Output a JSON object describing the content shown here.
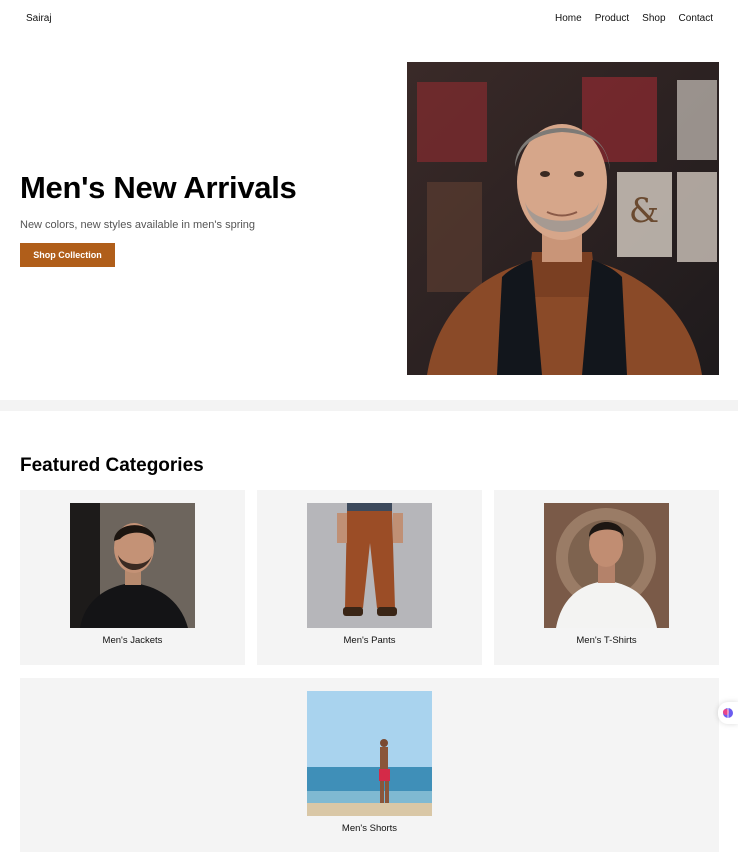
{
  "nav": {
    "brand": "Sairaj",
    "items": [
      {
        "label": "Home"
      },
      {
        "label": "Product"
      },
      {
        "label": "Shop"
      },
      {
        "label": "Contact"
      }
    ]
  },
  "hero": {
    "title": "Men's New Arrivals",
    "subtitle": "New colors, new styles available in men's spring",
    "button_label": "Shop Collection",
    "accent_color": "#b05e1a",
    "image": "man-in-brown-turtleneck-photo"
  },
  "categories": {
    "title": "Featured Categories",
    "items": [
      {
        "label": "Men's Jackets",
        "image": "man-in-black-jacket-photo"
      },
      {
        "label": "Men's Pants",
        "image": "brown-pants-photo"
      },
      {
        "label": "Men's T-Shirts",
        "image": "man-in-white-tshirt-photo"
      },
      {
        "label": "Men's Shorts",
        "image": "man-in-red-shorts-beach-photo"
      }
    ]
  },
  "widget": {
    "icon": "brain-icon"
  }
}
